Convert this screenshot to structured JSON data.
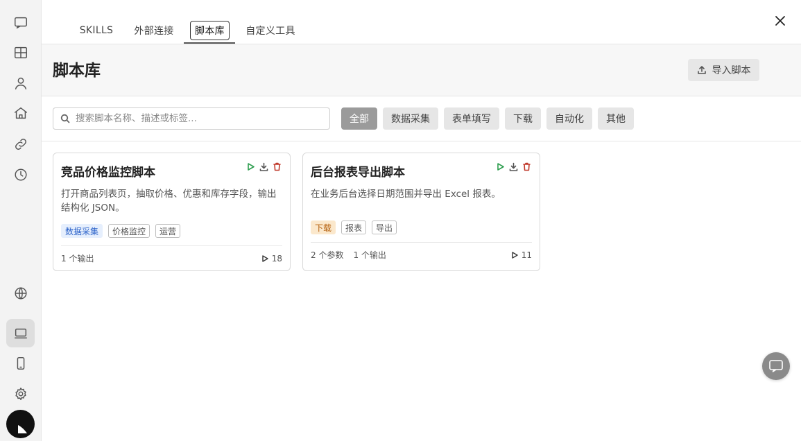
{
  "sidebar": {
    "icons": [
      "chat-icon",
      "layout-grid-icon",
      "user-icon",
      "home-icon",
      "link-icon",
      "history-icon",
      "globe-icon",
      "laptop-icon",
      "mobile-icon",
      "settings-icon"
    ],
    "active": "laptop-icon"
  },
  "tabs": [
    {
      "label": "SKILLS"
    },
    {
      "label": "外部连接"
    },
    {
      "label": "脚本库"
    },
    {
      "label": "自定义工具"
    }
  ],
  "active_tab": "脚本库",
  "header": {
    "title": "脚本库",
    "import_label": "导入脚本"
  },
  "search": {
    "placeholder": "搜索脚本名称、描述或标签...",
    "value": ""
  },
  "filters": [
    {
      "label": "全部",
      "active": true
    },
    {
      "label": "数据采集",
      "active": false
    },
    {
      "label": "表单填写",
      "active": false
    },
    {
      "label": "下载",
      "active": false
    },
    {
      "label": "自动化",
      "active": false
    },
    {
      "label": "其他",
      "active": false
    }
  ],
  "scripts": [
    {
      "title": "竞品价格监控脚本",
      "description": "打开商品列表页，抽取价格、优惠和库存字段，输出结构化 JSON。",
      "tags": [
        {
          "label": "数据采集",
          "style": "blue"
        },
        {
          "label": "价格监控",
          "style": "outline"
        },
        {
          "label": "运营",
          "style": "outline"
        }
      ],
      "footer": [
        "1 个输出"
      ],
      "runs": "18"
    },
    {
      "title": "后台报表导出脚本",
      "description": "在业务后台选择日期范围并导出 Excel 报表。",
      "tags": [
        {
          "label": "下载",
          "style": "orange"
        },
        {
          "label": "报表",
          "style": "outline"
        },
        {
          "label": "导出",
          "style": "outline"
        }
      ],
      "footer": [
        "2 个参数",
        "1 个输出"
      ],
      "runs": "11"
    }
  ],
  "colors": {
    "run": "#2e9e4f",
    "delete": "#c0392b",
    "tag_blue_bg": "#e6effd",
    "tag_orange_bg": "#fbe8cc"
  }
}
